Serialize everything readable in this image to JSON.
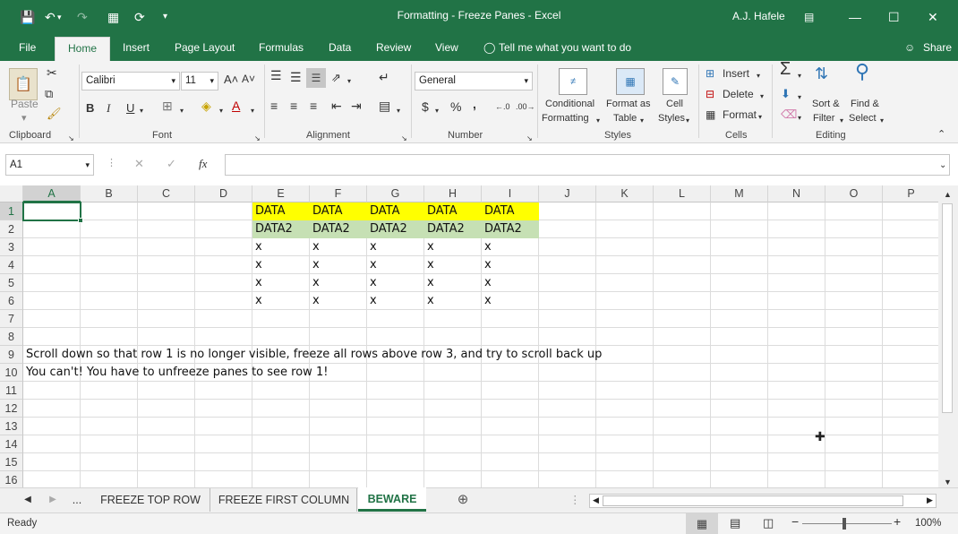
{
  "window": {
    "title": "Formatting - Freeze Panes  -  Excel",
    "user": "A.J. Hafele"
  },
  "ribbon_tabs": [
    "File",
    "Home",
    "Insert",
    "Page Layout",
    "Formulas",
    "Data",
    "Review",
    "View"
  ],
  "tell_me": "Tell me what you want to do",
  "share": "Share",
  "clipboard": {
    "paste": "Paste",
    "group": "Clipboard"
  },
  "font": {
    "name": "Calibri",
    "size": "11",
    "group": "Font",
    "bold": "B",
    "italic": "I",
    "underline": "U"
  },
  "alignment": {
    "group": "Alignment"
  },
  "number": {
    "format": "General",
    "currency": "$",
    "percent": "%",
    "comma": ",",
    "group": "Number"
  },
  "styles": {
    "conditional": "Conditional",
    "formatting": "Formatting",
    "format_as": "Format as",
    "table": "Table",
    "cell": "Cell",
    "cell_styles": "Styles",
    "group": "Styles"
  },
  "cells": {
    "insert": "Insert",
    "delete": "Delete",
    "format": "Format",
    "group": "Cells"
  },
  "editing": {
    "sort": "Sort &",
    "filter": "Filter",
    "find": "Find &",
    "select": "Select",
    "group": "Editing"
  },
  "formula_bar": {
    "name_box": "A1",
    "fx": "fx",
    "value": ""
  },
  "columns": [
    "A",
    "B",
    "C",
    "D",
    "E",
    "F",
    "G",
    "H",
    "I",
    "J",
    "K",
    "L",
    "M",
    "N",
    "O",
    "P"
  ],
  "rows": [
    "1",
    "2",
    "3",
    "4",
    "5",
    "6",
    "7",
    "8",
    "9",
    "10",
    "11",
    "12",
    "13",
    "14",
    "15",
    "16"
  ],
  "cells_data": {
    "row1": [
      "DATA",
      "DATA",
      "DATA",
      "DATA",
      "DATA"
    ],
    "row2": [
      "DATA2",
      "DATA2",
      "DATA2",
      "DATA2",
      "DATA2"
    ],
    "x": "x",
    "row9": "Scroll down so that row 1 is no longer visible, freeze all rows above row 3, and try to scroll back up",
    "row10": "You can't!  You have to unfreeze panes to see row 1!"
  },
  "colors": {
    "accent": "#217346",
    "row1_fill": "#ffff00",
    "row2_fill": "#c6e0b4"
  },
  "sheet_tabs": {
    "more": "...",
    "tabs": [
      "FREEZE TOP ROW",
      "FREEZE FIRST COLUMN",
      "BEWARE"
    ],
    "active": "BEWARE"
  },
  "status": {
    "ready": "Ready",
    "zoom": "100%"
  }
}
